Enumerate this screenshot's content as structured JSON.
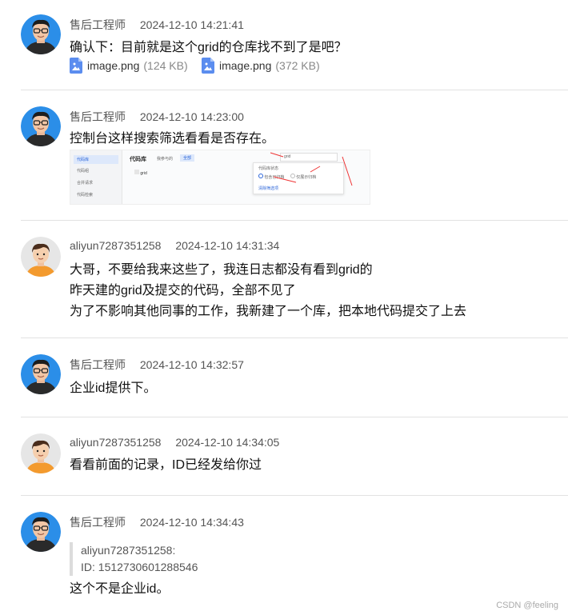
{
  "messages": [
    {
      "author": "售后工程师",
      "time": "2024-12-10 14:21:41",
      "lines": [
        "确认下：目前就是这个grid的仓库找不到了是吧？"
      ],
      "attachments": [
        {
          "name": "image.png",
          "size": "(124 KB)"
        },
        {
          "name": "image.png",
          "size": "(372 KB)"
        }
      ]
    },
    {
      "author": "售后工程师",
      "time": "2024-12-10 14:23:00",
      "lines": [
        "控制台这样搜索筛选看看是否存在。"
      ],
      "screenshot": {
        "sidebar": [
          "代码库",
          "代码组",
          "合并请求",
          "代码检索"
        ],
        "header_title": "代码库",
        "tab1": "我参与的",
        "tab2": "全部",
        "repo_name": "grid",
        "search_text": "grid",
        "filter_title": "代码库状态",
        "filter_opt1": "包含已归档",
        "filter_opt2": "仅展示归档",
        "filter_link": "清除筛选项"
      }
    },
    {
      "author": "aliyun7287351258",
      "time": "2024-12-10 14:31:34",
      "lines": [
        "大哥，不要给我来这些了，我连日志都没有看到grid的",
        "昨天建的grid及提交的代码，全部不见了",
        "为了不影响其他同事的工作，我新建了一个库，把本地代码提交了上去"
      ]
    },
    {
      "author": "售后工程师",
      "time": "2024-12-10 14:32:57",
      "lines": [
        "企业id提供下。"
      ]
    },
    {
      "author": "aliyun7287351258",
      "time": "2024-12-10 14:34:05",
      "lines": [
        "看看前面的记录，ID已经发给你过"
      ]
    },
    {
      "author": "售后工程师",
      "time": "2024-12-10 14:34:43",
      "quote": [
        "aliyun7287351258:",
        "ID: 1512730601288546"
      ],
      "lines": [
        "这个不是企业id。"
      ]
    }
  ],
  "watermark": "CSDN @feeling",
  "colors": {
    "file_icon": "#5b8def",
    "divider": "#e2e2e2"
  }
}
